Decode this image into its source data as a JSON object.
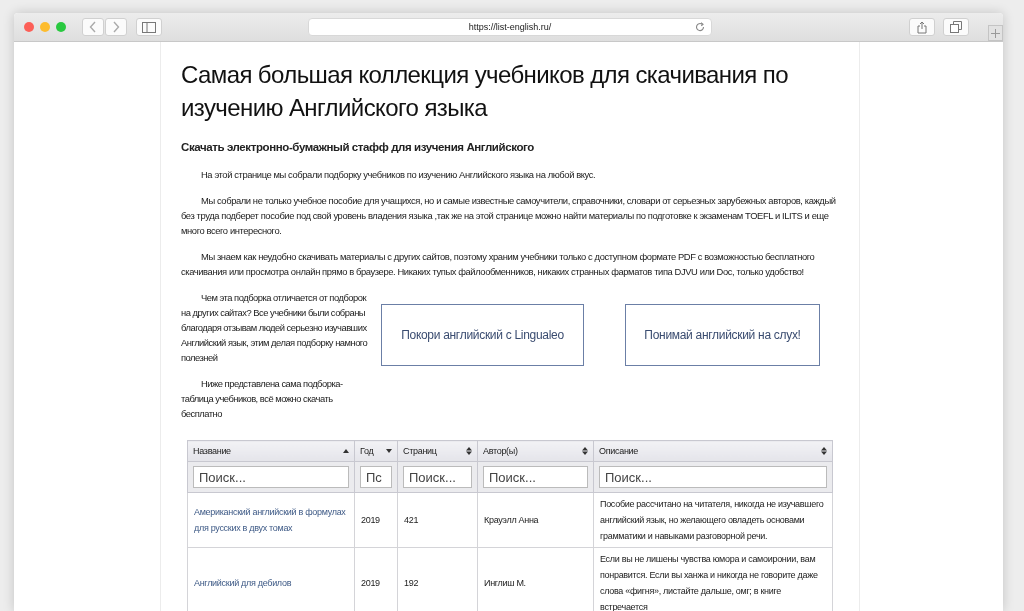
{
  "browser": {
    "url": "https://list-english.ru/"
  },
  "page": {
    "title": "Самая большая коллекция учебников для скачивания по изучению Английского языка",
    "subtitle": "Скачать электронно-бумажный стафф для изучения Английского",
    "paragraphs": [
      "На этой странице мы собрали подборку учебников по изучению Английского языка на любой вкус.",
      "Мы собрали не только учебное пособие для учащихся, но и самые известные самоучители, справочники, словари от серьезных зарубежных авторов, каждый без труда подберет пособие под свой уровень владения языка ,так же на этой странице можно найти материалы по подготовке к экзаменам TOEFL и ILITS и еще много всего интересного.",
      "Мы знаем как неудобно скачивать материалы с других сайтов, поэтому храним учебники только с доступном формате PDF с возможностью бесплатного скачивания или просмотра онлайн прямо в браузере. Никаких тупых файлообменников, никаких странных фарматов типа DJVU или Doc, только удобство!"
    ],
    "side_paragraphs": [
      "Чем эта подборка отличается от подборок на других сайтах? Все учебники были собраны благодаря отзывам людей серьезно изучавших Английский язык, этим делая подборку намного полезней",
      "Ниже представлена сама подборка-таблица учебников, всё можно скачать бесплатно"
    ],
    "buttons": [
      "Покори английский с Lingualeo",
      "Понимай английский на слух!"
    ]
  },
  "table": {
    "columns": [
      {
        "label": "Название",
        "sorted": true,
        "descending": false,
        "placeholder": "Поиск..."
      },
      {
        "label": "Год",
        "sorted": true,
        "descending": true,
        "placeholder": "Пс"
      },
      {
        "label": "Страниц",
        "sorted": false,
        "placeholder": "Поиск..."
      },
      {
        "label": "Автор(ы)",
        "sorted": false,
        "placeholder": "Поиск..."
      },
      {
        "label": "Описание",
        "sorted": false,
        "placeholder": "Поиск..."
      }
    ],
    "rows": [
      {
        "title": "Американский английский в формулах для русских в двух томах",
        "year": "2019",
        "pages": "421",
        "authors": "Крауэлл Анна",
        "description": "Пособие рассчитано на читателя, никогда не изучавшего английский язык, но желающего овладеть основами грамматики и навыками разговорной речи."
      },
      {
        "title": "Английский для дебилов",
        "year": "2019",
        "pages": "192",
        "authors": "Инглиш М.",
        "description": "Если вы не лишены чувства юмора и самоиронии, вам понравится. Если вы ханжа и никогда не говорите даже слова «фигня», листайте дальше, омг; в книге встречается"
      }
    ]
  }
}
